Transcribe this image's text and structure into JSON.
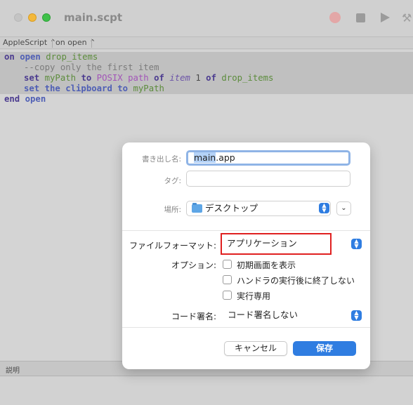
{
  "window": {
    "title": "main.scpt"
  },
  "navbar": {
    "language": "AppleScript ⌃",
    "handler": "on open ⌃"
  },
  "code": {
    "line1": {
      "kw1": "on",
      "ev": " open",
      "var": " drop_items"
    },
    "line2": {
      "comment": "--copy only the first item"
    },
    "line3": {
      "set": "set",
      "v1": " myPath",
      "to": " to",
      "posix": " POSIX",
      "path": " path",
      "of": " of",
      "item": " item",
      "one": " 1",
      "of2": " of",
      "v2": " drop_items"
    },
    "line4": {
      "set": "set the clipboard to",
      "v1": " myPath"
    },
    "line5": {
      "end": "end",
      "ev": " open"
    }
  },
  "description_pane": {
    "label": "説明"
  },
  "sheet": {
    "export_as_label": "書き出し名:",
    "export_name_selected": "main",
    "export_name_ext": ".app",
    "tags_label": "タグ:",
    "where_label": "場所:",
    "where_value": "デスクトップ",
    "file_format_label": "ファイルフォーマット:",
    "file_format_value": "アプリケーション",
    "options_label": "オプション:",
    "options": [
      {
        "label": "初期画面を表示",
        "checked": false
      },
      {
        "label": "ハンドラの実行後に終了しない",
        "checked": false
      },
      {
        "label": "実行専用",
        "checked": false
      }
    ],
    "code_sign_label": "コード署名:",
    "code_sign_value": "コード署名しない",
    "cancel_label": "キャンセル",
    "save_label": "保存"
  },
  "colors": {
    "accent": "#2f7de1",
    "highlight_box": "#e02020"
  }
}
